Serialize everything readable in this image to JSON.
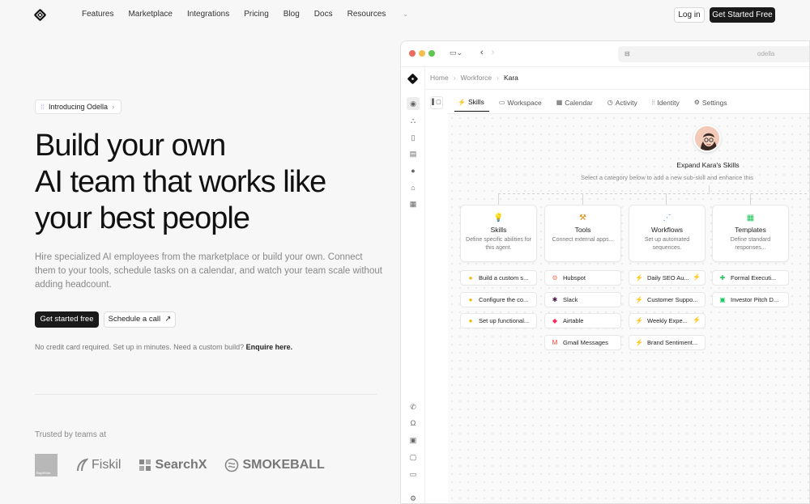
{
  "nav": {
    "links": [
      "Features",
      "Marketplace",
      "Integrations",
      "Pricing",
      "Blog",
      "Docs",
      "Resources"
    ],
    "login": "Log in",
    "get_started": "Get Started Free"
  },
  "hero": {
    "pill": "Introducing Odella",
    "headline": [
      "Build your own",
      "AI team that works like",
      "your best people"
    ],
    "subtitle": "Hire specialized AI employees from the marketplace or build your own. Connect them to your tools, schedule tasks on a calendar, and watch your team scale without adding headcount.",
    "cta_primary": "Get started free",
    "cta_secondary": "Schedule a call",
    "note": "No credit card required. Set up in minutes. Need a custom build?",
    "note_link": "Enquire here.",
    "trusted": "Trusted by teams at",
    "logos": [
      "Fiskil",
      "SearchX",
      "SMOKEBALL"
    ],
    "logo_bw_label": "BayWhite"
  },
  "app": {
    "url_domain": "odella",
    "breadcrumb": [
      "Home",
      "Workforce",
      "Kara"
    ],
    "tabs": [
      "Skills",
      "Workspace",
      "Calendar",
      "Activity",
      "Identity",
      "Settings"
    ],
    "expand_title": "Expand Kara's Skills",
    "expand_sub": "Select a category below to add a new sub-skill and enhance this",
    "categories": [
      {
        "title": "Skills",
        "desc": "Define specific abilities for this agent."
      },
      {
        "title": "Tools",
        "desc": "Connect external apps..."
      },
      {
        "title": "Workflows",
        "desc": "Set up automated sequences."
      },
      {
        "title": "Templates",
        "desc": "Define standard responses..."
      }
    ],
    "skills_items": [
      "Build a custom s...",
      "Configure the co...",
      "Set up functional..."
    ],
    "tools_items": [
      "Hubspot",
      "Slack",
      "Airtable",
      "Gmail Messages"
    ],
    "workflow_items": [
      "Daily SEO Au...",
      "Customer Suppo...",
      "Weekly Expe...",
      "Brand Sentiment..."
    ],
    "template_items": [
      "Formal Executi...",
      "Investor Pitch D..."
    ]
  },
  "colors": {
    "accent_dark": "#1a1a1a",
    "traffic_red": "#ec6a5e",
    "traffic_yellow": "#f4bf4f",
    "traffic_green": "#61c554",
    "skill_yellow": "#f2b705",
    "workflow_blue": "#3b82f6",
    "hubspot_orange": "#ff7a59"
  }
}
